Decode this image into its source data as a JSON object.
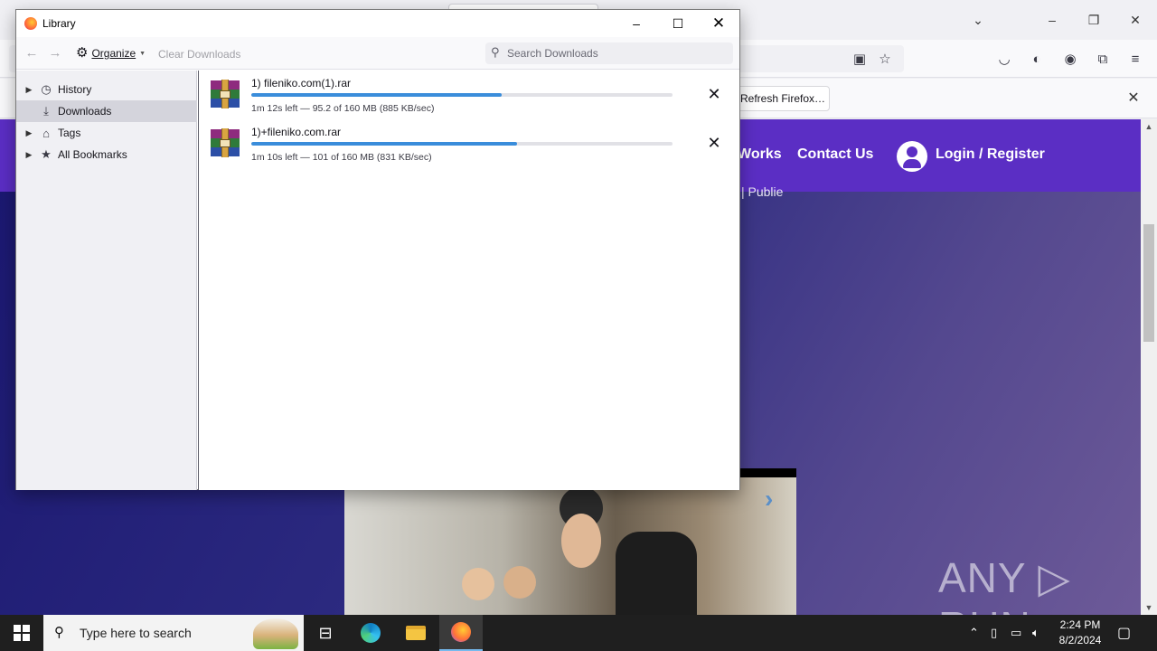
{
  "browser": {
    "notification": {
      "button_label": "Refresh Firefox…"
    },
    "site": {
      "nav": [
        "Works",
        "Contact Us",
        "Login / Register"
      ],
      "subtext": "| Publie"
    },
    "watermark": "ANY ▷ RUN"
  },
  "library": {
    "title": "Library",
    "toolbar": {
      "organize_label": "Organize",
      "clear_downloads_label": "Clear Downloads",
      "search_placeholder": "Search Downloads"
    },
    "sidebar": [
      {
        "label": "History",
        "icon": "clock-icon",
        "expandable": true
      },
      {
        "label": "Downloads",
        "icon": "download-icon",
        "expandable": false,
        "selected": true
      },
      {
        "label": "Tags",
        "icon": "tag-icon",
        "expandable": true
      },
      {
        "label": "All Bookmarks",
        "icon": "star-icon",
        "expandable": true
      }
    ],
    "downloads": [
      {
        "name": "1) fileniko.com(1).rar",
        "status": "1m 12s left — 95.2 of 160 MB (885 KB/sec)",
        "progress": 0.595
      },
      {
        "name": "1)+fileniko.com.rar",
        "status": "1m 10s left — 101 of 160 MB (831 KB/sec)",
        "progress": 0.631
      }
    ]
  },
  "taskbar": {
    "search_placeholder": "Type here to search",
    "time": "2:24 PM",
    "date": "8/2/2024"
  },
  "colors": {
    "accent": "#3a8ddb",
    "site_header": "#5b2ec4",
    "page_background": "#2a2174"
  }
}
